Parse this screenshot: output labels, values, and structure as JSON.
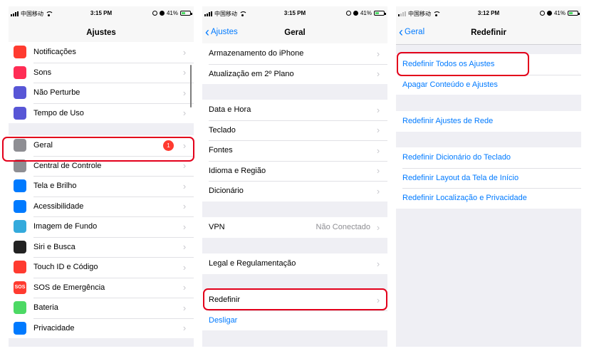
{
  "status_panels": [
    {
      "carrier": "中国移动",
      "time": "3:15 PM",
      "battery": "41%"
    },
    {
      "carrier": "中国移动",
      "time": "3:15 PM",
      "battery": "41%"
    },
    {
      "carrier": "中国移动",
      "time": "3:12 PM",
      "battery": "41%"
    }
  ],
  "panel1": {
    "title": "Ajustes",
    "group1": [
      {
        "label": "Notificações",
        "icon": "notifications-icon",
        "color": "#ff3b30"
      },
      {
        "label": "Sons",
        "icon": "sounds-icon",
        "color": "#ff2d55"
      },
      {
        "label": "Não Perturbe",
        "icon": "moon-icon",
        "color": "#5856d6"
      },
      {
        "label": "Tempo de Uso",
        "icon": "hourglass-icon",
        "color": "#5856d6"
      }
    ],
    "group2": [
      {
        "label": "Geral",
        "icon": "gear-icon",
        "color": "#8e8e93",
        "badge": "1"
      },
      {
        "label": "Central de Controle",
        "icon": "switches-icon",
        "color": "#8e8e93"
      },
      {
        "label": "Tela e Brilho",
        "icon": "text-size-icon",
        "color": "#007aff"
      },
      {
        "label": "Acessibilidade",
        "icon": "accessibility-icon",
        "color": "#007aff"
      },
      {
        "label": "Imagem de Fundo",
        "icon": "flower-icon",
        "color": "#34aadc"
      },
      {
        "label": "Siri e Busca",
        "icon": "siri-icon",
        "color": "#222222"
      },
      {
        "label": "Touch ID e Código",
        "icon": "fingerprint-icon",
        "color": "#ff3b30"
      },
      {
        "label": "SOS de Emergência",
        "icon": "sos-icon",
        "color": "#ff3b30",
        "icon_text": "SOS"
      },
      {
        "label": "Bateria",
        "icon": "battery-icon",
        "color": "#4cd964"
      },
      {
        "label": "Privacidade",
        "icon": "hand-icon",
        "color": "#007aff"
      }
    ]
  },
  "panel2": {
    "title": "Geral",
    "back": "Ajustes",
    "group1": [
      "Armazenamento do iPhone",
      "Atualização em 2º Plano"
    ],
    "group2": [
      "Data e Hora",
      "Teclado",
      "Fontes",
      "Idioma e Região",
      "Dicionário"
    ],
    "vpn": {
      "label": "VPN",
      "value": "Não Conectado"
    },
    "legal": "Legal e Regulamentação",
    "reset": "Redefinir",
    "shutdown": "Desligar"
  },
  "panel3": {
    "title": "Redefinir",
    "back": "Geral",
    "group1": [
      "Redefinir Todos os Ajustes",
      "Apagar Conteúdo e Ajustes"
    ],
    "group2": [
      "Redefinir Ajustes de Rede"
    ],
    "group3": [
      "Redefinir Dicionário do Teclado",
      "Redefinir Layout da Tela de Início",
      "Redefinir Localização e Privacidade"
    ]
  },
  "colors": {
    "accent": "#007aff",
    "highlight": "#e3001b",
    "badge": "#ff3b30"
  }
}
